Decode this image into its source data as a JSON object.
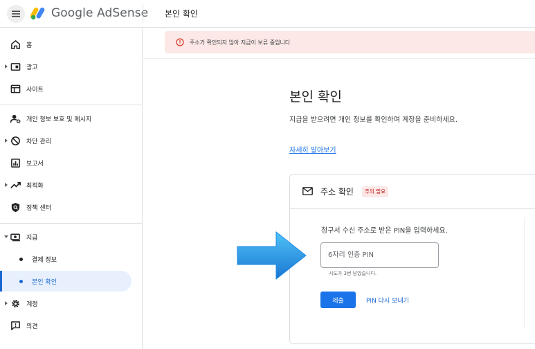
{
  "header": {
    "app_name": "Google AdSense",
    "page_title": "본인 확인"
  },
  "sidebar": {
    "items": [
      {
        "label": "홈"
      },
      {
        "label": "광고"
      },
      {
        "label": "사이트"
      },
      {
        "label": "개인 정보 보호 및 메시지"
      },
      {
        "label": "차단 관리"
      },
      {
        "label": "보고서"
      },
      {
        "label": "최적화"
      },
      {
        "label": "정책 센터"
      },
      {
        "label": "지급"
      },
      {
        "label": "계정"
      },
      {
        "label": "의견"
      }
    ],
    "sub_items": [
      {
        "label": "결제 정보"
      },
      {
        "label": "본인 확인"
      }
    ]
  },
  "alert": {
    "text": "주소가 확인되지 않아 지급이 보류 중입니다"
  },
  "main": {
    "heading": "본인 확인",
    "description": "지급을 받으려면 개인 정보를 확인하여 계정을 준비하세요.",
    "learn_more": "자세히 알아보기"
  },
  "card": {
    "title": "주소 확인",
    "badge": "주의 필요",
    "instruction": "청구서 수신 주소로 받은 PIN을 입력하세요.",
    "pin_placeholder": "6자리 인증 PIN",
    "attempts_note": "시도가 3번 남았습니다.",
    "submit_label": "제출",
    "resend_label": "PIN 다시 보내기"
  },
  "colors": {
    "accent": "#1a73e8",
    "alert_bg": "#fce8e6",
    "alert_red": "#d93025",
    "active_nav_bg": "#e8f0fe",
    "arrow_blue": "#1e9bf0"
  }
}
